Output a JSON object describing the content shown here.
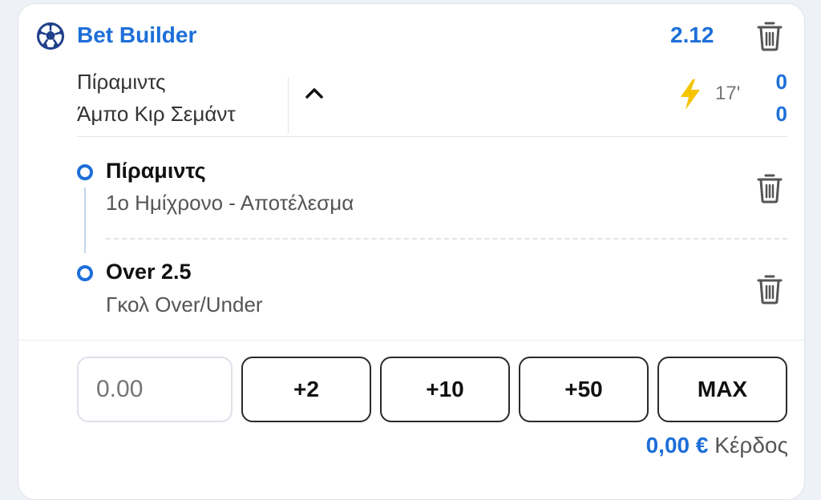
{
  "header": {
    "title": "Bet Builder",
    "odds": "2.12"
  },
  "match": {
    "home": "Πίραμιντς",
    "away": "Άμπο Κιρ Σεμάντ",
    "minute": "17'",
    "home_score": "0",
    "away_score": "0"
  },
  "selections": [
    {
      "name": "Πίραμιντς",
      "market": "1ο Ημίχρονο - Αποτέλεσμα"
    },
    {
      "name": "Over 2.5",
      "market": "Γκολ Over/Under"
    }
  ],
  "stake": {
    "placeholder": "0.00",
    "quick": [
      "+2",
      "+10",
      "+50",
      "MAX"
    ]
  },
  "payout": {
    "amount": "0,00 €",
    "label": "Κέρδος"
  },
  "icons": {
    "sport": "soccer-ball-icon",
    "delete": "trash-icon",
    "collapse": "chevron-up-icon",
    "live": "lightning-icon"
  },
  "colors": {
    "accent": "#1d6fd8",
    "live": "#f5c400"
  }
}
